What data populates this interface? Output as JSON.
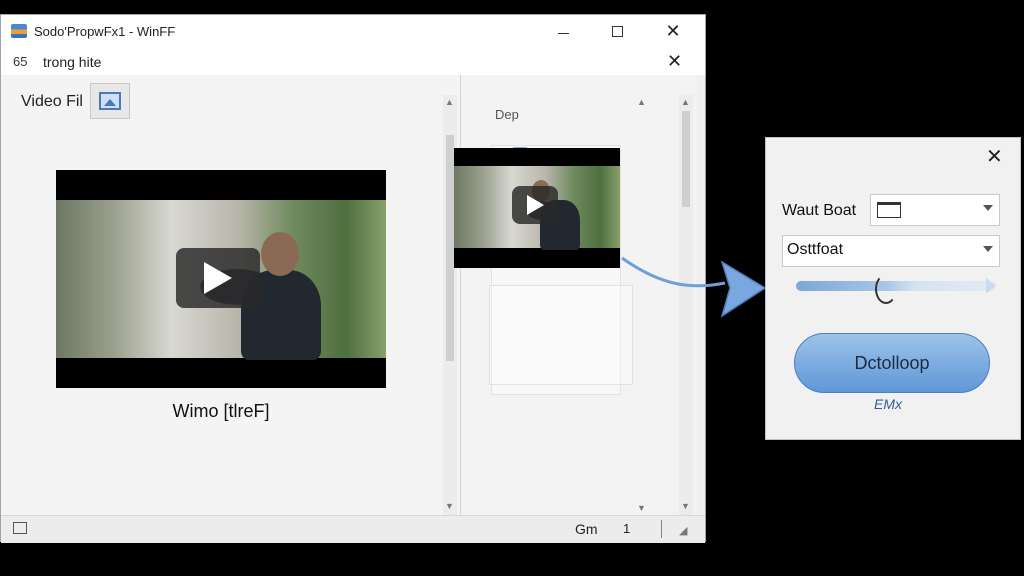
{
  "window": {
    "title": "Sodo'PropwFx1 - WinFF",
    "second_bar": {
      "left": "65",
      "text": "trong hite"
    }
  },
  "left_pane": {
    "video_file_label": "Video Fil",
    "video_caption": "Wimo [tlreF]"
  },
  "right_pane": {
    "deep_label": "Dep"
  },
  "statusbar": {
    "gm": "Gm",
    "count": "1"
  },
  "dialog": {
    "label1": "Waut Boat",
    "select2": "Osttfoat",
    "button_label": "Dctolloop",
    "sub_label": "EMx",
    "slider_fraction": 0.45,
    "accent": "#5f97d6"
  },
  "icons": {
    "app": "winff-app-icon",
    "close": "close-icon",
    "maximize": "maximize-icon",
    "minimize": "minimize-icon",
    "picture": "picture-icon",
    "folder": "folder-icon",
    "play": "play-icon"
  }
}
